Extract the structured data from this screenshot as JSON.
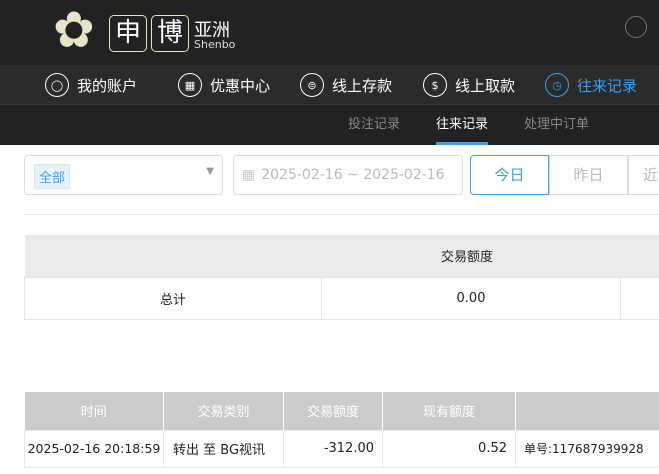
{
  "brand": {
    "logo_chars": [
      "申",
      "博"
    ],
    "name": "亚洲",
    "sub": "Shenbo"
  },
  "nav": [
    {
      "label": "我的账户",
      "icon": "user-icon"
    },
    {
      "label": "优惠中心",
      "icon": "gift-icon"
    },
    {
      "label": "线上存款",
      "icon": "deposit-icon"
    },
    {
      "label": "线上取款",
      "icon": "withdraw-icon"
    },
    {
      "label": "往来记录",
      "icon": "records-icon",
      "active": true
    }
  ],
  "subnav": [
    {
      "label": "投注记录"
    },
    {
      "label": "往来记录",
      "active": true
    },
    {
      "label": "处理中订单"
    }
  ],
  "filters": {
    "type_tag": "全部",
    "date_range": "2025-02-16 ~ 2025-02-16",
    "quick": [
      "今日",
      "昨日",
      "近"
    ]
  },
  "summary": {
    "header": "交易额度",
    "label": "总计",
    "value": "0.00"
  },
  "records": {
    "columns": [
      "时间",
      "交易类别",
      "交易额度",
      "现有额度",
      ""
    ],
    "rows": [
      [
        "2025-02-16 20:18:59",
        "转出 至 BG视讯",
        "-312.00",
        "0.52",
        "单号:117687939928"
      ]
    ]
  },
  "colors": {
    "accent": "#3aa0f0",
    "header_bg": "#222222"
  }
}
